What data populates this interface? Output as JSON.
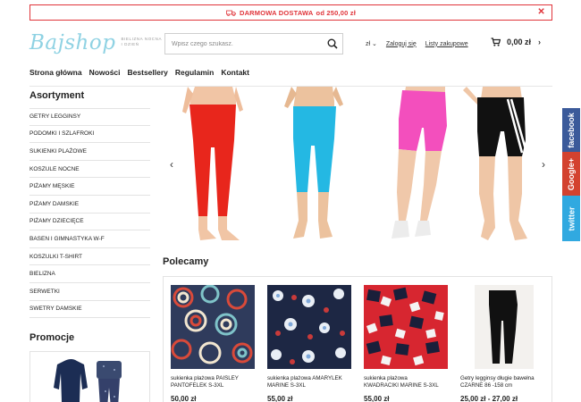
{
  "banner": {
    "text": "DARMOWA DOSTAWA",
    "amount": "od 250,00 zł",
    "close": "✕"
  },
  "logo": {
    "text": "Bajshop",
    "tagline_1": "BIELIZNA NOCNA",
    "tagline_2": "I DZIEŃ"
  },
  "search": {
    "placeholder": "Wpisz czego szukasz."
  },
  "header": {
    "currency": "zł ⌄",
    "login": "Zaloguj się",
    "shopping_list": "Listy zakupowe",
    "cart_total": "0,00 zł",
    "chevron": "›"
  },
  "nav": {
    "items": [
      "Strona główna",
      "Nowości",
      "Bestsellery",
      "Regulamin",
      "Kontakt"
    ]
  },
  "sidebar": {
    "title": "Asortyment",
    "items": [
      "GETRY LEGGINSY",
      "PODOMKI I SZLAFROKI",
      "SUKIENKI PLAŻOWE",
      "KOSZULE NOCNE",
      "PIŻAMY MĘSKIE",
      "PIŻAMY DAMSKIE",
      "PIŻAMY DZIECIĘCE",
      "BASEN I GIMNASTYKA W-F",
      "KOSZULKI T-SHIRT",
      "BIELIZNA",
      "SERWETKI",
      "SWETRY DAMSKIE"
    ],
    "promo_title": "Promocje"
  },
  "slider": {
    "prev": "‹",
    "next": "›"
  },
  "recommended": {
    "title": "Polecamy",
    "products": [
      {
        "name_1": "sukienka plażowa PAISLEY",
        "name_2": "PANTOFELEK S-3XL",
        "price": "50,00 zł"
      },
      {
        "name_1": "sukienka plażowa AMARYLEK",
        "name_2": "MARINE S-3XL",
        "price": "55,00 zł"
      },
      {
        "name_1": "sukienka plażowa",
        "name_2": "KWADRACIKI MARINE S-3XL",
        "price": "55,00 zł"
      },
      {
        "name_1": "Getry legginsy długie bawełna",
        "name_2": "CZARNE 86 -158 cm",
        "price": "25,00 zł - 27,00 zł"
      }
    ]
  },
  "social": {
    "facebook": "facebook",
    "google": "Google+",
    "twitter": "twitter"
  },
  "colors": {
    "accent_red": "#e0343a",
    "logo_blue": "#8fd2e3",
    "facebook": "#3b5a9a",
    "google": "#d3422f",
    "twitter": "#31a9e0"
  },
  "icons": [
    "truck-icon",
    "close-icon",
    "search-icon",
    "cart-icon",
    "chevron-right-icon",
    "chevron-left-icon"
  ]
}
